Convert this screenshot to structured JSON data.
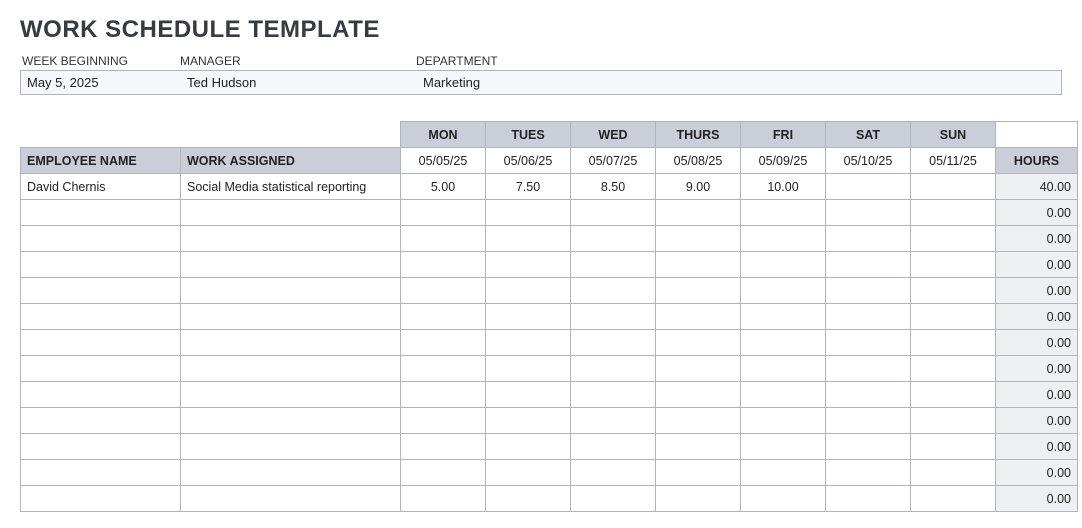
{
  "title": "WORK SCHEDULE TEMPLATE",
  "meta": {
    "labels": {
      "week": "WEEK BEGINNING",
      "manager": "MANAGER",
      "department": "DEPARTMENT"
    },
    "values": {
      "week": "May 5, 2025",
      "manager": "Ted Hudson",
      "department": "Marketing"
    }
  },
  "headers": {
    "employee": "EMPLOYEE NAME",
    "work": "WORK ASSIGNED",
    "hours": "HOURS",
    "days": [
      "MON",
      "TUES",
      "WED",
      "THURS",
      "FRI",
      "SAT",
      "SUN"
    ],
    "dates": [
      "05/05/25",
      "05/06/25",
      "05/07/25",
      "05/08/25",
      "05/09/25",
      "05/10/25",
      "05/11/25"
    ]
  },
  "rows": [
    {
      "employee": "David Chernis",
      "work": "Social Media statistical reporting",
      "d": [
        "5.00",
        "7.50",
        "8.50",
        "9.00",
        "10.00",
        "",
        ""
      ],
      "hours": "40.00"
    },
    {
      "employee": "",
      "work": "",
      "d": [
        "",
        "",
        "",
        "",
        "",
        "",
        ""
      ],
      "hours": "0.00"
    },
    {
      "employee": "",
      "work": "",
      "d": [
        "",
        "",
        "",
        "",
        "",
        "",
        ""
      ],
      "hours": "0.00"
    },
    {
      "employee": "",
      "work": "",
      "d": [
        "",
        "",
        "",
        "",
        "",
        "",
        ""
      ],
      "hours": "0.00"
    },
    {
      "employee": "",
      "work": "",
      "d": [
        "",
        "",
        "",
        "",
        "",
        "",
        ""
      ],
      "hours": "0.00"
    },
    {
      "employee": "",
      "work": "",
      "d": [
        "",
        "",
        "",
        "",
        "",
        "",
        ""
      ],
      "hours": "0.00"
    },
    {
      "employee": "",
      "work": "",
      "d": [
        "",
        "",
        "",
        "",
        "",
        "",
        ""
      ],
      "hours": "0.00"
    },
    {
      "employee": "",
      "work": "",
      "d": [
        "",
        "",
        "",
        "",
        "",
        "",
        ""
      ],
      "hours": "0.00"
    },
    {
      "employee": "",
      "work": "",
      "d": [
        "",
        "",
        "",
        "",
        "",
        "",
        ""
      ],
      "hours": "0.00"
    },
    {
      "employee": "",
      "work": "",
      "d": [
        "",
        "",
        "",
        "",
        "",
        "",
        ""
      ],
      "hours": "0.00"
    },
    {
      "employee": "",
      "work": "",
      "d": [
        "",
        "",
        "",
        "",
        "",
        "",
        ""
      ],
      "hours": "0.00"
    },
    {
      "employee": "",
      "work": "",
      "d": [
        "",
        "",
        "",
        "",
        "",
        "",
        ""
      ],
      "hours": "0.00"
    },
    {
      "employee": "",
      "work": "",
      "d": [
        "",
        "",
        "",
        "",
        "",
        "",
        ""
      ],
      "hours": "0.00"
    }
  ]
}
